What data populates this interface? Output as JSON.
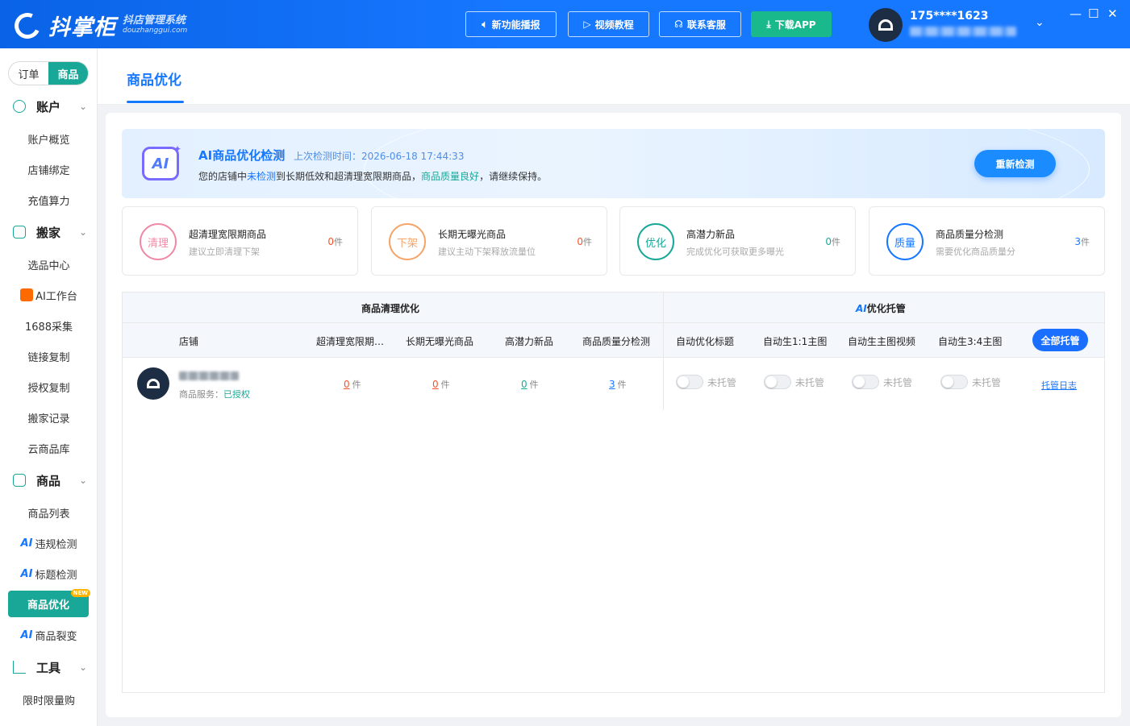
{
  "header": {
    "logo_text": "抖掌柜",
    "logo_subtitle": "抖店管理系统",
    "logo_domain": "douzhanggui.com",
    "buttons": [
      {
        "label": "新功能播报",
        "icon": "speaker-icon"
      },
      {
        "label": "视频教程",
        "icon": "video-icon"
      },
      {
        "label": "联系客服",
        "icon": "headset-icon"
      },
      {
        "label": "下载APP",
        "icon": "download-icon"
      }
    ],
    "user": {
      "phone": "175****1623"
    },
    "window_controls": {
      "minimize": "—",
      "maximize": "☐",
      "close": "✕"
    }
  },
  "sidebar": {
    "segment": {
      "left": "订单",
      "right": "商品",
      "active": "商品"
    },
    "groups": [
      {
        "label": "账户",
        "icon": "smile-icon",
        "items": [
          {
            "label": "账户概览"
          },
          {
            "label": "店铺绑定"
          },
          {
            "label": "充值算力"
          }
        ]
      },
      {
        "label": "搬家",
        "icon": "box-icon",
        "items": [
          {
            "label": "选品中心"
          },
          {
            "label": "AI工作台",
            "badge": "hot"
          },
          {
            "label": "1688采集"
          },
          {
            "label": "链接复制"
          },
          {
            "label": "授权复制"
          },
          {
            "label": "搬家记录"
          },
          {
            "label": "云商品库"
          }
        ]
      },
      {
        "label": "商品",
        "icon": "shop-icon",
        "items": [
          {
            "label": "商品列表"
          },
          {
            "label": "违规检测",
            "prefix": "AI"
          },
          {
            "label": "标题检测",
            "prefix": "AI"
          },
          {
            "label": "商品优化",
            "active": true,
            "badge": "NEW"
          },
          {
            "label": "商品裂变",
            "prefix": "AI"
          }
        ]
      },
      {
        "label": "工具",
        "icon": "chart-line-icon",
        "items": [
          {
            "label": "限时限量购"
          }
        ]
      }
    ]
  },
  "page": {
    "tab": "商品优化",
    "banner": {
      "title": "AI商品优化检测",
      "time_label": "上次检测时间：2026-06-18 17:44:33",
      "desc_1": "您的店铺中",
      "desc_2": "未检测",
      "desc_3": "到长期低效和超清理宽限期商品，",
      "desc_4": "商品质量良好",
      "desc_5": "，请继续保持。",
      "button": "重新检测",
      "icon_text": "AI"
    },
    "cards": [
      {
        "circle": "清理",
        "title": "超清理宽限期商品",
        "sub": "建议立即清理下架",
        "value": "0",
        "unit": "件",
        "color": "#f08aa6",
        "value_color": "#f5532d"
      },
      {
        "circle": "下架",
        "title": "长期无曝光商品",
        "sub": "建议主动下架释放流量位",
        "value": "0",
        "unit": "件",
        "color": "#f5a56a",
        "value_color": "#f5532d"
      },
      {
        "circle": "优化",
        "title": "高潜力新品",
        "sub": "完成优化可获取更多曝光",
        "value": "0",
        "unit": "件",
        "color": "#19a898",
        "value_color": "#19a898"
      },
      {
        "circle": "质量",
        "title": "商品质量分检测",
        "sub": "需要优化商品质量分",
        "value": "3",
        "unit": "件",
        "color": "#1677ff",
        "value_color": "#1677ff"
      }
    ],
    "table": {
      "group_left": "商品清理优化",
      "group_right_ai": "AI",
      "group_right": "优化托管",
      "columns": [
        "店铺",
        "超清理宽限期…",
        "长期无曝光商品",
        "高潜力新品",
        "商品质量分检测",
        "自动优化标题",
        "自动生1:1主图",
        "自动生主图视频",
        "自动生3:4主图"
      ],
      "all_button": "全部托管",
      "rows": [
        {
          "service_label": "商品服务：",
          "service_status": "已授权",
          "counts": [
            {
              "value": "0",
              "unit": "件",
              "color": "#f5532d"
            },
            {
              "value": "0",
              "unit": "件",
              "color": "#f5532d"
            },
            {
              "value": "0",
              "unit": "件",
              "color": "#19a898"
            },
            {
              "value": "3",
              "unit": "件",
              "color": "#1677ff"
            }
          ],
          "switches": [
            {
              "label": "未托管",
              "on": false
            },
            {
              "label": "未托管",
              "on": false
            },
            {
              "label": "未托管",
              "on": false
            },
            {
              "label": "未托管",
              "on": false
            }
          ],
          "log_link": "托管日志"
        }
      ]
    }
  }
}
